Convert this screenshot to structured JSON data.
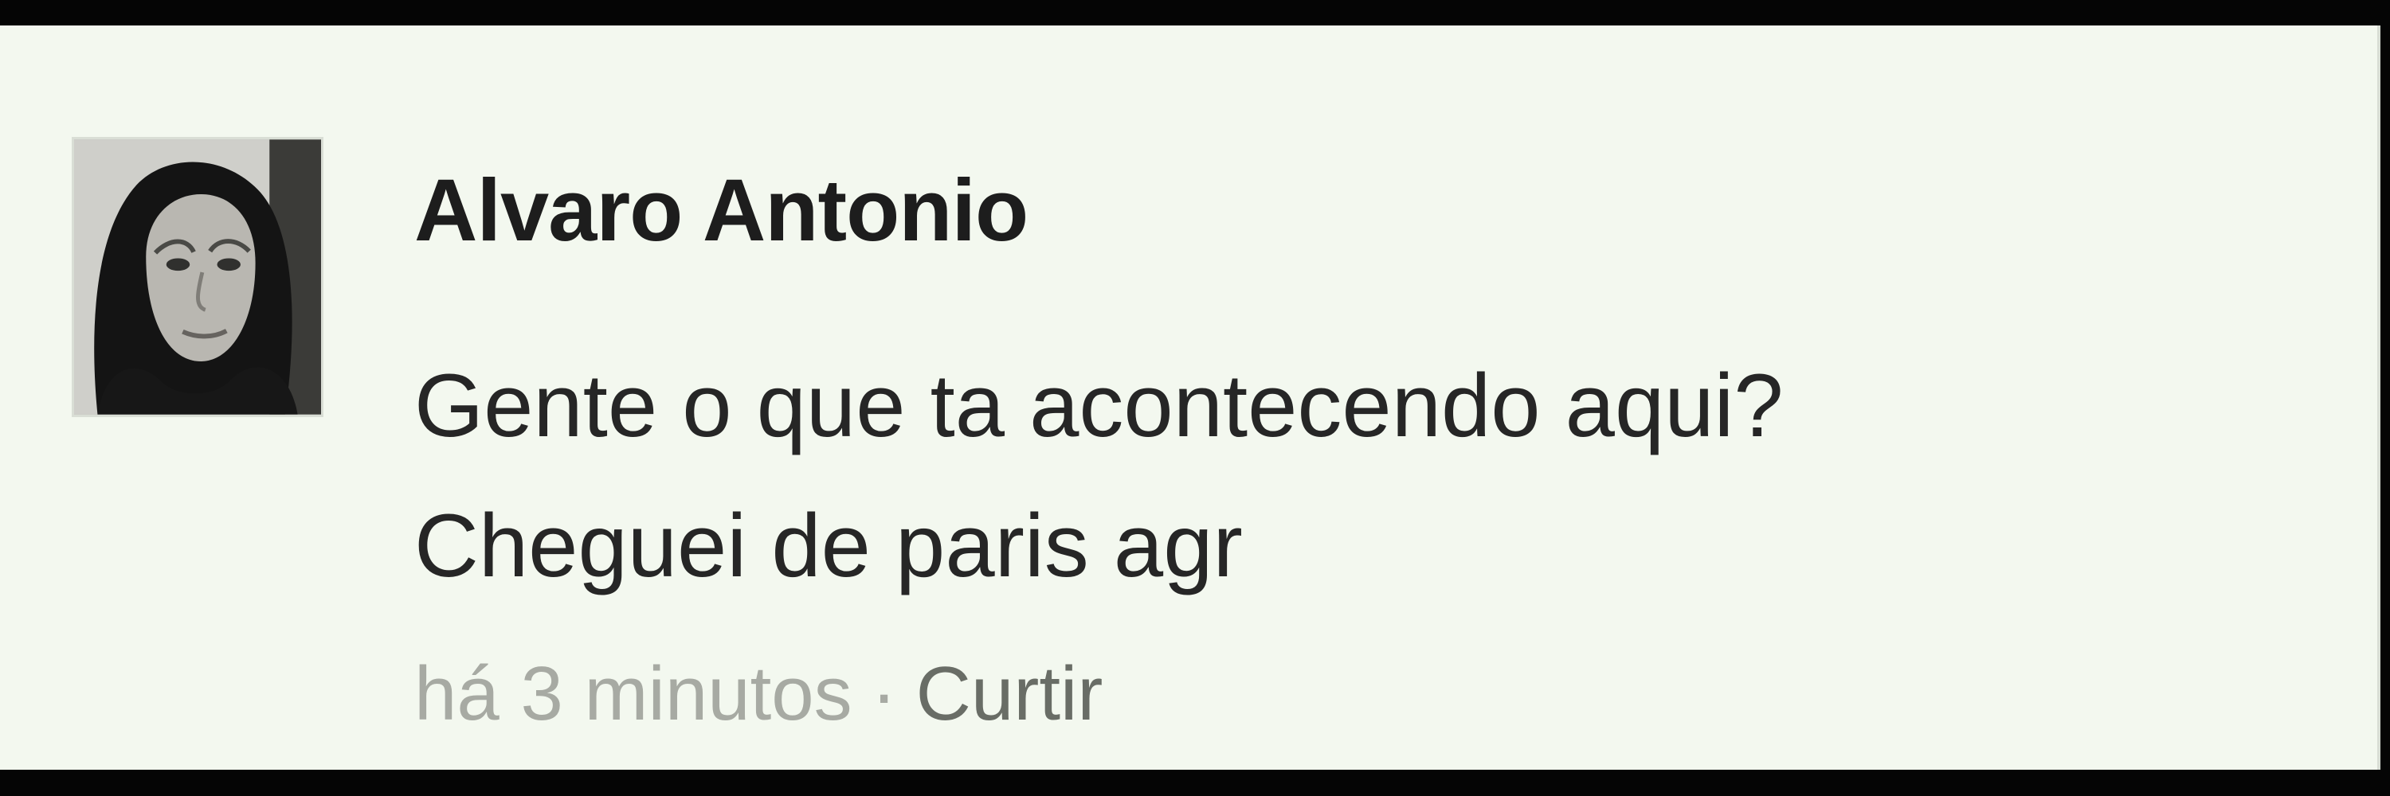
{
  "comment": {
    "author": "Alvaro Antonio",
    "message_lines": [
      "Gente o que ta acontecendo aqui?",
      "Cheguei de paris agr"
    ],
    "timestamp": "há 3 minutos",
    "separator": "·",
    "like_label": "Curtir"
  },
  "icons": {
    "avatar": "profile-photo"
  },
  "colors": {
    "background": "#f3f8ef",
    "author_text": "#1d1d1d",
    "message_text": "#262626",
    "timestamp_text": "#a7aaa3",
    "action_text": "#696d66",
    "outer_border": "#050505"
  }
}
